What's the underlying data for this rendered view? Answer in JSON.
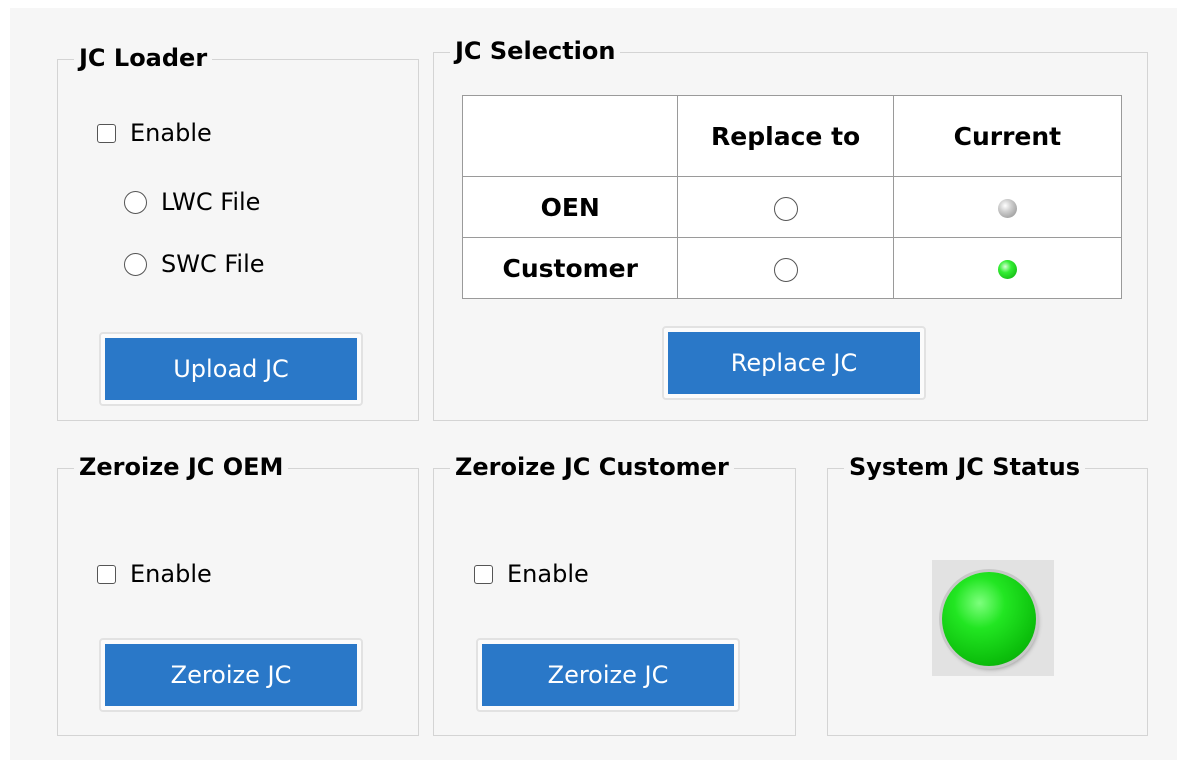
{
  "jc_loader": {
    "title": "JC Loader",
    "enable_label": "Enable",
    "enable_checked": false,
    "lwc_label": "LWC File",
    "swc_label": "SWC File",
    "upload_button": "Upload JC"
  },
  "jc_selection": {
    "title": "JC Selection",
    "columns": [
      "",
      "Replace to",
      "Current"
    ],
    "rows": [
      {
        "label": "OEN",
        "replace_selected": false,
        "current_status": "gray"
      },
      {
        "label": "Customer",
        "replace_selected": false,
        "current_status": "green"
      }
    ],
    "replace_button": "Replace JC"
  },
  "zeroize_oem": {
    "title": "Zeroize JC OEM",
    "enable_label": "Enable",
    "enable_checked": false,
    "button": "Zeroize JC"
  },
  "zeroize_customer": {
    "title": "Zeroize JC Customer",
    "enable_label": "Enable",
    "enable_checked": false,
    "button": "Zeroize JC"
  },
  "system_status": {
    "title": "System JC Status",
    "led_status": "green"
  },
  "colors": {
    "button_blue": "#2a78c8",
    "led_green": "#22e622",
    "led_gray": "#a0a0a0",
    "panel_background": "#f6f6f6"
  }
}
